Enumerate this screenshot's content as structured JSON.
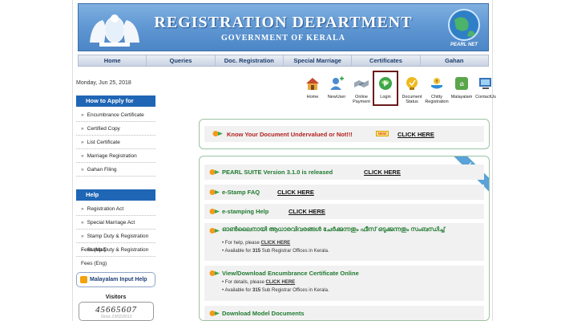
{
  "header": {
    "title": "REGISTRATION DEPARTMENT",
    "subtitle": "GOVERNMENT OF KERALA",
    "globe_text": "PEARL NET"
  },
  "nav": [
    {
      "label": "Home"
    },
    {
      "label": "Queries"
    },
    {
      "label": "Doc. Registration"
    },
    {
      "label": "Special Marriage"
    },
    {
      "label": "Certificates"
    },
    {
      "label": "Gahan"
    }
  ],
  "date": "Monday, Jun 25, 2018",
  "icons": [
    {
      "label": "Home",
      "color": "#d98a2b"
    },
    {
      "label": "NewUser",
      "color": "#4c8ad1"
    },
    {
      "label": "Online Payment",
      "color": "#9aa7b5"
    },
    {
      "label": "Login",
      "color": "#3ea64a"
    },
    {
      "label": "Document Status",
      "color": "#f0b91e"
    },
    {
      "label": "Chitty Registration",
      "color": "#2c8fd6"
    },
    {
      "label": "Malayalam",
      "color": "#5aa64a"
    },
    {
      "label": "ContactUs",
      "color": "#3874b8"
    }
  ],
  "sidebar": {
    "how_to_apply": {
      "title": "How to Apply for",
      "items": [
        "Encumbrance Certificate",
        "Certified Copy",
        "List Certificate",
        "Marriage Registration",
        "Gahan Filing"
      ]
    },
    "help": {
      "title": "Help",
      "items": [
        "Registration Act",
        "Special Marriage Act",
        "Stamp Duty & Registration Fees (Mal)",
        "Stamp Duty & Registration Fees (Eng)"
      ]
    },
    "malayalam_help": "Malayalam Input Help",
    "visitors_label": "Visitors",
    "visitors_count": "45665607",
    "visitors_since": "Since 23/02/2013"
  },
  "know_doc": {
    "text": "Know Your Document Undervalued or Not!!!",
    "badge": "NEW",
    "link": "CLICK HERE"
  },
  "links_ribbon": "Links",
  "links": {
    "pearl": {
      "text": "PEARL SUITE Version 3.1.0 is released",
      "link": "CLICK HERE"
    },
    "estamp_faq": {
      "text": "e-Stamp FAQ",
      "link": "CLICK HERE"
    },
    "estamp_help": {
      "text": "e-stamping Help",
      "link": "CLICK HERE"
    },
    "aadhaar": {
      "text": "ഓൺലൈനായി ആധാരവിവരങ്ങൾ ചേർക്കുന്നതും ഫീസ് ഒടുക്കുന്നതും സംബന്ധിച്ച്",
      "help_prefix": "For help, please",
      "help_link": "CLICK HERE",
      "avail_prefix": "Available for",
      "avail_count": "315",
      "avail_suffix": "Sub Registrar Offices in Kerala."
    },
    "encumbrance": {
      "text": "View/Download Encumbrance Certificate Online",
      "help_prefix": "For details, please",
      "help_link": "CLICK HERE",
      "avail_prefix": "Available for",
      "avail_count": "315",
      "avail_suffix": "Sub Registrar Offices in Kerala."
    },
    "model_docs": {
      "text": "Download Model Documents"
    }
  }
}
